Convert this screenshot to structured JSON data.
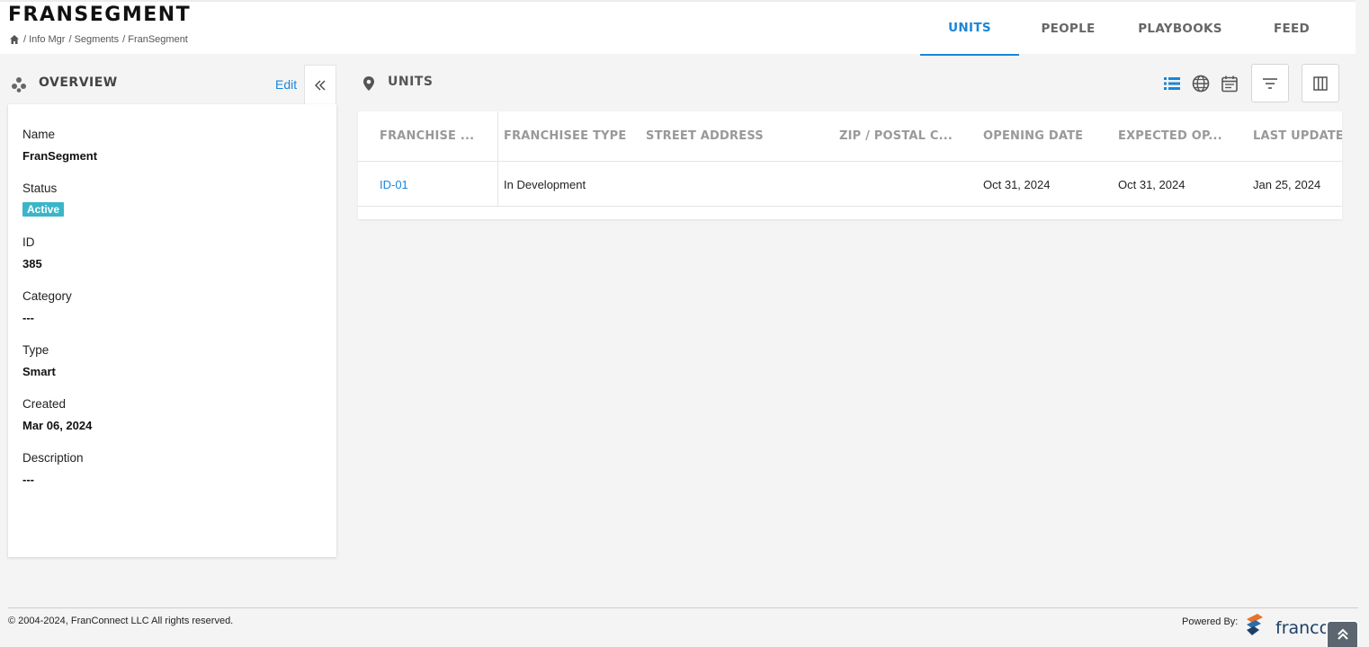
{
  "header": {
    "title": "FRANSEGMENT",
    "breadcrumb": [
      "/ Info Mgr",
      "/ Segments",
      "/ FranSegment"
    ]
  },
  "tabs": [
    {
      "label": "UNITS",
      "active": true
    },
    {
      "label": "PEOPLE",
      "active": false
    },
    {
      "label": "PLAYBOOKS",
      "active": false
    },
    {
      "label": "FEED",
      "active": false
    }
  ],
  "overview": {
    "title": "OVERVIEW",
    "edit_label": "Edit",
    "fields": {
      "name": {
        "label": "Name",
        "value": "FranSegment"
      },
      "status": {
        "label": "Status",
        "value": "Active"
      },
      "id": {
        "label": "ID",
        "value": "385"
      },
      "category": {
        "label": "Category",
        "value": "---"
      },
      "type": {
        "label": "Type",
        "value": "Smart"
      },
      "created": {
        "label": "Created",
        "value": "Mar 06, 2024"
      },
      "description": {
        "label": "Description",
        "value": "---"
      }
    }
  },
  "units": {
    "title": "UNITS",
    "columns": [
      "FRANCHISE ...",
      "FRANCHISEE TYPE",
      "STREET ADDRESS",
      "ZIP / POSTAL C...",
      "OPENING DATE",
      "EXPECTED OP...",
      "LAST UPDATE"
    ],
    "rows": [
      {
        "franchise": "ID-01",
        "franchisee_type": "In Development",
        "street_address": "",
        "zip": "",
        "opening_date": "Oct 31, 2024",
        "expected_opening": "Oct 31, 2024",
        "last_update": "Jan 25, 2024"
      }
    ]
  },
  "footer": {
    "copyright": "© 2004-2024, FranConnect LLC All rights reserved.",
    "powered_by": "Powered By:",
    "brand": "franconnect"
  },
  "colors": {
    "accent": "#1a86d9",
    "status_active": "#3bb6c9",
    "background": "#f4f4f4"
  },
  "icons": [
    "home-icon",
    "overview-icon",
    "chevrons-left-icon",
    "map-pin-icon",
    "list-view-icon",
    "globe-icon",
    "calendar-icon",
    "filter-icon",
    "columns-icon",
    "double-chevron-up-icon"
  ]
}
